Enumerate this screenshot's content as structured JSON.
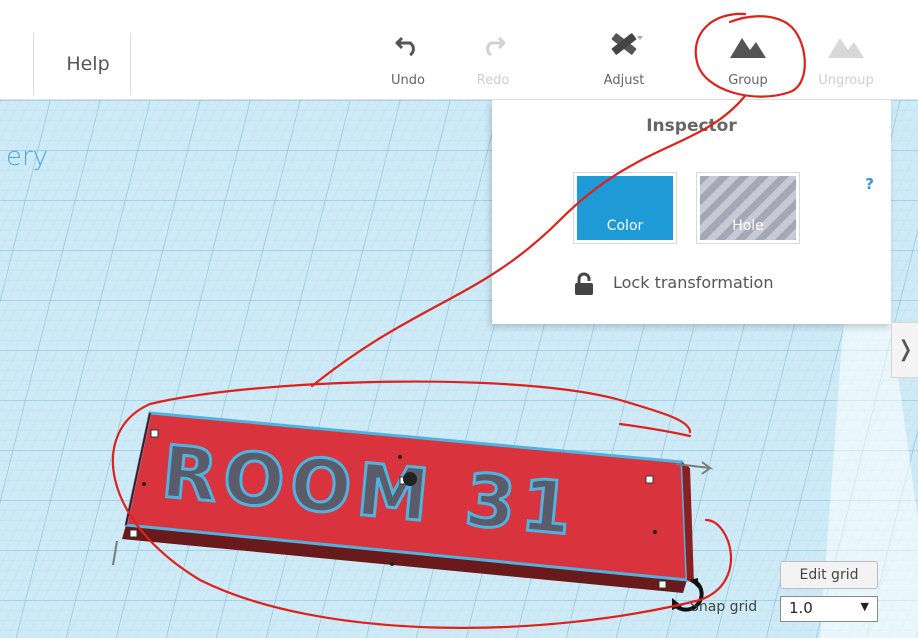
{
  "toolbar": {
    "help_label": "Help",
    "undo_label": "Undo",
    "redo_label": "Redo",
    "adjust_label": "Adjust",
    "group_label": "Group",
    "ungroup_label": "Ungroup"
  },
  "workplane": {
    "gallery_text": "ery",
    "model_text": "ROOM 31",
    "edit_grid_label": "Edit grid",
    "snap_grid_label": "Snap grid",
    "snap_grid_value": "1.0"
  },
  "inspector": {
    "title": "Inspector",
    "help_mark": "?",
    "color_label": "Color",
    "hole_label": "Hole",
    "lock_label": "Lock transformation"
  },
  "colors": {
    "workplane": "#cfeaf7",
    "grid": "#9ccfe6",
    "accent": "#1e9ad6",
    "model_red": "#d9333d",
    "annotation_red": "#e0201a"
  }
}
